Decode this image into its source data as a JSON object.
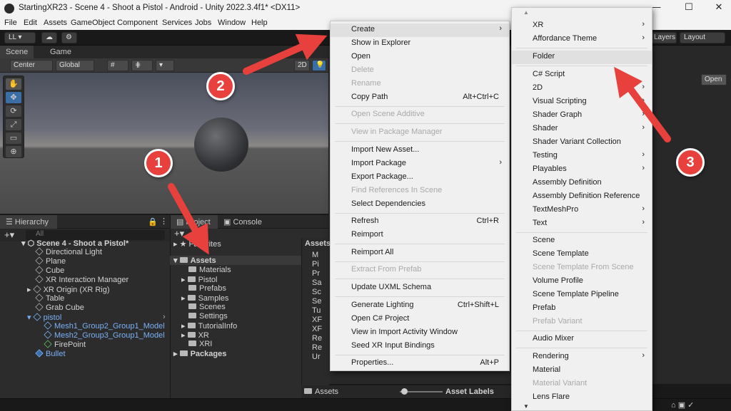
{
  "window": {
    "title": "StartingXR23 - Scene 4 - Shoot a Pistol - Android - Unity 2022.3.4f1* <DX11>",
    "min": "—",
    "max": "☐",
    "close": "✕"
  },
  "menubar": [
    "File",
    "Edit",
    "Assets",
    "GameObject",
    "Component",
    "Services",
    "Jobs",
    "Window",
    "Help"
  ],
  "toolbar": {
    "account": "LL ▾",
    "layers": "Layers",
    "layout": "Layout",
    "open": "Open"
  },
  "tabs": {
    "scene": "Scene",
    "game": "Game",
    "hierarchy": "Hierarchy",
    "project": "Project",
    "console": "Console"
  },
  "scene_tools": {
    "center": "Center",
    "global": "Global",
    "mode_2d": "2D"
  },
  "hierarchy": {
    "search_placeholder": "All",
    "root": "Scene 4 - Shoot a Pistol*",
    "items": [
      "Directional Light",
      "Plane",
      "Cube",
      "XR Interaction Manager",
      "XR Origin (XR Rig)",
      "Table",
      "Grab Cube",
      "pistol",
      "Mesh1_Group2_Group1_Model",
      "Mesh2_Group3_Group1_Model",
      "FirePoint",
      "Bullet"
    ]
  },
  "project": {
    "favorites": "Favorites",
    "assets": "Assets",
    "folders": [
      "Materials",
      "Pistol",
      "Prefabs",
      "Samples",
      "Scenes",
      "Settings",
      "TutorialInfo",
      "XR",
      "XRI"
    ],
    "packages": "Packages",
    "col_header": "Assets",
    "col_items": [
      "M",
      "Pi",
      "Pr",
      "Sa",
      "Sc",
      "Se",
      "Tu",
      "XF",
      "XF",
      "Re",
      "Re",
      "Ur"
    ],
    "breadcrumb": "Assets",
    "asset_labels": "Asset Labels"
  },
  "context_menu": [
    {
      "label": "Create",
      "arrow": "›",
      "hl": true
    },
    {
      "label": "Show in Explorer"
    },
    {
      "label": "Open"
    },
    {
      "label": "Delete",
      "dis": true
    },
    {
      "label": "Rename",
      "dis": true
    },
    {
      "label": "Copy Path",
      "sc": "Alt+Ctrl+C"
    },
    {
      "label": "Open Scene Additive",
      "dis": true
    },
    {
      "label": "View in Package Manager",
      "dis": true
    },
    {
      "label": "Import New Asset..."
    },
    {
      "label": "Import Package",
      "arrow": "›"
    },
    {
      "label": "Export Package..."
    },
    {
      "label": "Find References In Scene",
      "dis": true
    },
    {
      "label": "Select Dependencies"
    },
    {
      "label": "Refresh",
      "sc": "Ctrl+R"
    },
    {
      "label": "Reimport"
    },
    {
      "label": "Reimport All"
    },
    {
      "label": "Extract From Prefab",
      "dis": true
    },
    {
      "label": "Update UXML Schema"
    },
    {
      "label": "Generate Lighting",
      "sc": "Ctrl+Shift+L"
    },
    {
      "label": "Open C# Project"
    },
    {
      "label": "View in Import Activity Window"
    },
    {
      "label": "Seed XR Input Bindings"
    },
    {
      "label": "Properties...",
      "sc": "Alt+P"
    }
  ],
  "submenu": [
    {
      "label": "XR",
      "arrow": "›"
    },
    {
      "label": "Affordance Theme",
      "arrow": "›"
    },
    {
      "label": "Folder",
      "hl": true
    },
    {
      "label": "C# Script"
    },
    {
      "label": "2D",
      "arrow": "›"
    },
    {
      "label": "Visual Scripting",
      "arrow": "›"
    },
    {
      "label": "Shader Graph",
      "arrow": "›"
    },
    {
      "label": "Shader",
      "arrow": "›"
    },
    {
      "label": "Shader Variant Collection"
    },
    {
      "label": "Testing",
      "arrow": "›"
    },
    {
      "label": "Playables",
      "arrow": "›"
    },
    {
      "label": "Assembly Definition"
    },
    {
      "label": "Assembly Definition Reference"
    },
    {
      "label": "TextMeshPro",
      "arrow": "›"
    },
    {
      "label": "Text",
      "arrow": "›"
    },
    {
      "label": "Scene"
    },
    {
      "label": "Scene Template"
    },
    {
      "label": "Scene Template From Scene",
      "dis": true
    },
    {
      "label": "Volume Profile"
    },
    {
      "label": "Scene Template Pipeline"
    },
    {
      "label": "Prefab"
    },
    {
      "label": "Prefab Variant",
      "dis": true
    },
    {
      "label": "Audio Mixer"
    },
    {
      "label": "Rendering",
      "arrow": "›"
    },
    {
      "label": "Material"
    },
    {
      "label": "Material Variant",
      "dis": true
    },
    {
      "label": "Lens Flare"
    }
  ],
  "callouts": [
    "1",
    "2",
    "3"
  ]
}
